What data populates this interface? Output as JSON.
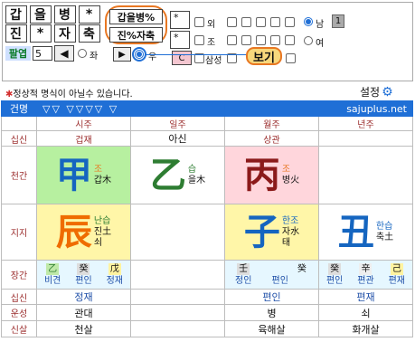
{
  "top": {
    "row1": [
      "갑",
      "을",
      "병",
      "*"
    ],
    "row2": [
      "진",
      "*",
      "자",
      "축"
    ],
    "palyeop_label": "팔엽",
    "palyeop_value": "5",
    "left_arrow": "◀",
    "left_radio_label": "좌",
    "input_gan": "갑을병%",
    "input_ji": "진%자축",
    "right_arrow": "▶",
    "right_radio_label": "우",
    "star1": "*",
    "star2": "*",
    "oe_label": "외",
    "jo_label": "조",
    "c_button": "C",
    "samseong_label": "삼성",
    "view_button": "보기",
    "gender_male": "남",
    "gender_female": "여",
    "gender_code": "1"
  },
  "notice": "정상적 명식이 아닐수 있습니다.",
  "settings_label": "설정",
  "settings_icon": "gear-icon",
  "header": {
    "label": "건명",
    "triangles": "▽▽  ▽▽▽▽  ▽",
    "site": "sajuplus.net"
  },
  "columns": [
    "시주",
    "일주",
    "월주",
    "년주"
  ],
  "row_labels": {
    "sipsin": "십신",
    "cheongan": "천간",
    "jiji": "지지",
    "janggan": "장간",
    "sipsin2": "십신",
    "unseong": "운성",
    "sinsal": "신살"
  },
  "sipsin_top": [
    "겁재",
    "아신",
    "상관",
    ""
  ],
  "stems": [
    {
      "char": "甲",
      "note1": "조",
      "note2": "갑木",
      "color": "#1565c0",
      "bg": "#b7f0a0"
    },
    {
      "char": "乙",
      "note1": "습",
      "note2": "을木",
      "color": "#2e7d32",
      "bg": "#ffffff"
    },
    {
      "char": "丙",
      "note1": "조",
      "note2": "병火",
      "color": "#8b1a1a",
      "bg": "#ffd6dc"
    },
    {
      "char": "",
      "note1": "",
      "note2": "",
      "color": "#000000",
      "bg": "#ffffff"
    }
  ],
  "branches": [
    {
      "char": "辰",
      "note1": "난습",
      "note2": "진土",
      "note3": "쇠",
      "color": "#ef6c00",
      "bg": "#fff6a8"
    },
    {
      "char": "",
      "note1": "",
      "note2": "",
      "note3": "",
      "color": "#000000",
      "bg": "#ffffff"
    },
    {
      "char": "子",
      "note1": "한조",
      "note2": "자水",
      "note3": "태",
      "color": "#1565c0",
      "bg": "#fff6a8"
    },
    {
      "char": "丑",
      "note1": "한습",
      "note2": "축土",
      "note3": "",
      "color": "#1565c0",
      "bg": "#ffffff"
    }
  ],
  "janggan": [
    {
      "chars": [
        "乙",
        "癸",
        "戊"
      ],
      "labels": [
        "비견",
        "편인",
        "정재"
      ]
    },
    {
      "chars": [
        "",
        "",
        ""
      ],
      "labels": [
        "",
        "",
        ""
      ]
    },
    {
      "chars": [
        "壬",
        "",
        "癸"
      ],
      "labels": [
        "정인",
        "편인",
        ""
      ]
    },
    {
      "chars": [
        "癸",
        "辛",
        "己"
      ],
      "labels": [
        "편인",
        "편관",
        "편재"
      ]
    }
  ],
  "sipsin_bottom": [
    "정재",
    "",
    "편인",
    "편재"
  ],
  "unseong": [
    "관대",
    "",
    "병",
    "쇠"
  ],
  "sinsal": [
    "천살",
    "",
    "육해살",
    "화개살"
  ],
  "colors": {
    "header_bg": "#1f6fd6",
    "accent_orange": "#e87722",
    "label_red": "#9b2d2d",
    "sipsin_blue": "#1f4fa8"
  }
}
